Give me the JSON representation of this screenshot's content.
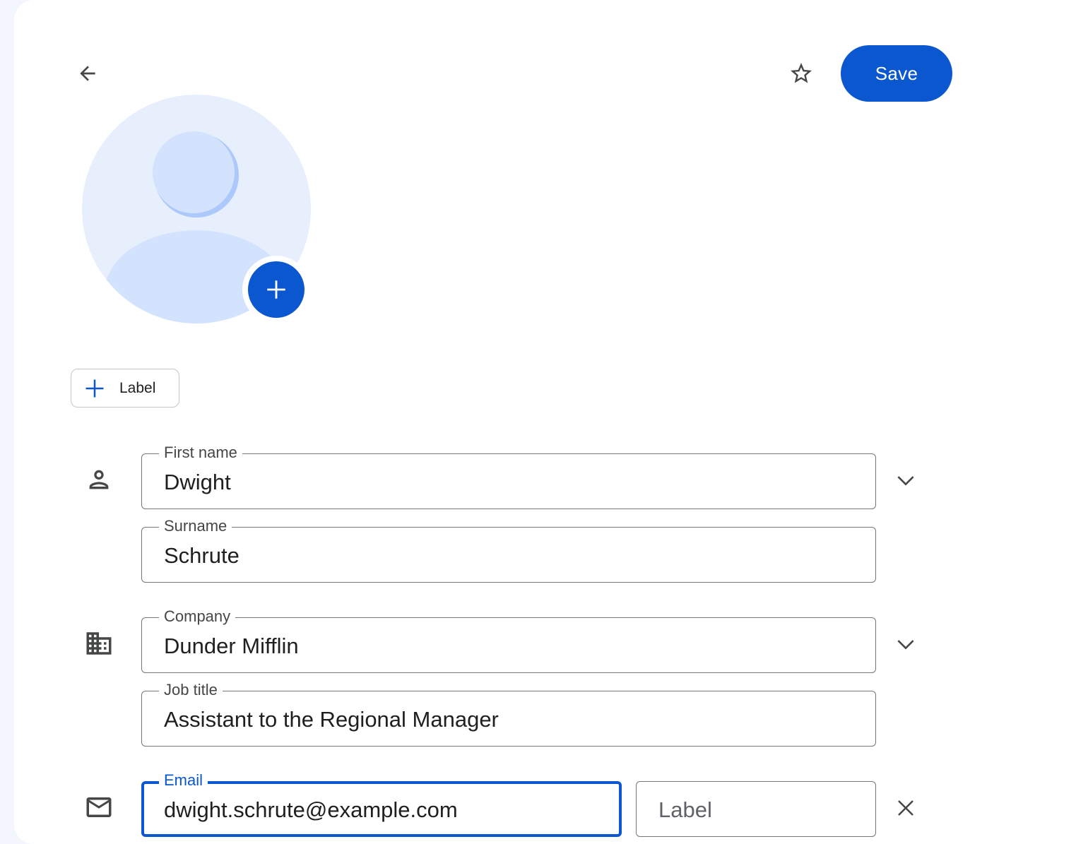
{
  "header": {
    "back_icon": "arrow-back-icon",
    "star_icon": "star-outline-icon",
    "save_label": "Save"
  },
  "avatar": {
    "placeholder_icon": "person-silhouette",
    "add_photo_icon": "plus-icon"
  },
  "label_chip": {
    "icon": "plus-icon",
    "text": "Label"
  },
  "name_section": {
    "icon": "person-icon",
    "first_name": {
      "label": "First name",
      "value": "Dwight"
    },
    "surname": {
      "label": "Surname",
      "value": "Schrute"
    },
    "expand_icon": "chevron-down-icon"
  },
  "company_section": {
    "icon": "building-icon",
    "company": {
      "label": "Company",
      "value": "Dunder Mifflin"
    },
    "job_title": {
      "label": "Job title",
      "value": "Assistant to the Regional Manager"
    },
    "expand_icon": "chevron-down-icon"
  },
  "email_section": {
    "icon": "mail-icon",
    "email": {
      "label": "Email",
      "value": "dwight.schrute@example.com"
    },
    "email_label": {
      "placeholder": "Label"
    },
    "remove_icon": "close-icon"
  },
  "colors": {
    "primary": "#0b57d0",
    "avatar_bg": "#e7effd",
    "outline": "#747775"
  }
}
